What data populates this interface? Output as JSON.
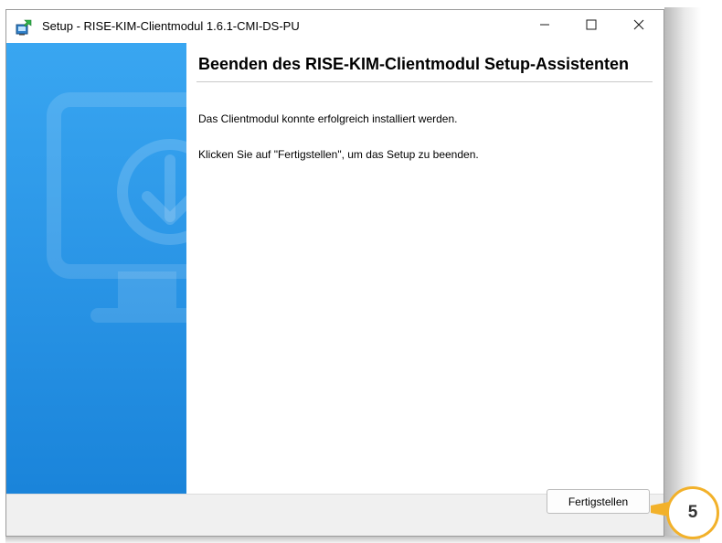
{
  "window": {
    "title": "Setup - RISE-KIM-Clientmodul 1.6.1-CMI-DS-PU"
  },
  "titlebar_icons": {
    "app": "setup-installer-icon",
    "minimize": "minimize-icon",
    "maximize": "maximize-icon",
    "close": "close-icon"
  },
  "sidebar": {
    "illustration": "monitor-download-icon"
  },
  "content": {
    "heading": "Beenden des RISE-KIM-Clientmodul Setup-Assistenten",
    "line1": "Das Clientmodul konnte erfolgreich installiert werden.",
    "line2": "Klicken Sie auf \"Fertigstellen\", um das Setup zu beenden."
  },
  "footer": {
    "finish_label": "Fertigstellen"
  },
  "annotation": {
    "step_number": "5",
    "color": "#f2b12a"
  },
  "colors": {
    "sidebar_top": "#39a6f1",
    "sidebar_bottom": "#1a84da",
    "footer_bg": "#f0f0f0"
  }
}
